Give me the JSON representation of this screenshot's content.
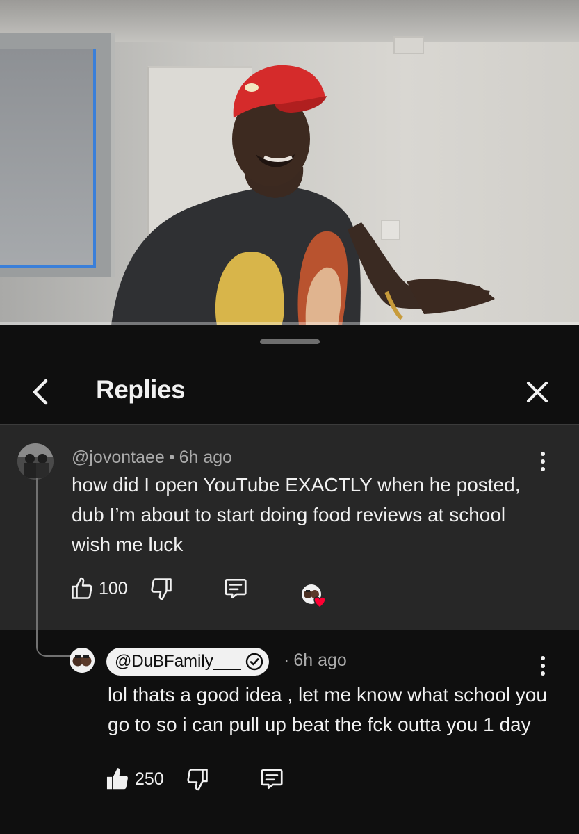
{
  "video": {
    "progress_fraction": 0.0
  },
  "header": {
    "title": "Replies",
    "back_icon": "chevron-left-icon",
    "close_icon": "close-icon"
  },
  "parent_comment": {
    "username": "@jovontaee",
    "separator": "•",
    "time": "6h ago",
    "text": "how did I open YouTube EXACTLY when he posted, dub I’m about to start doing food reviews at school wish me luck",
    "likes": "100",
    "icons": [
      "thumbs-up-icon",
      "thumbs-down-icon",
      "reply-icon",
      "creator-heart-icon",
      "more-icon"
    ]
  },
  "reply_comment": {
    "username": "@DuBFamily___",
    "verified": true,
    "separator": "·",
    "time": "6h ago",
    "text": "lol thats a good idea , let me know what school you go to so i can pull up beat the fck outta you 1 day",
    "likes": "250",
    "liked": true,
    "icons": [
      "thumbs-up-filled-icon",
      "thumbs-down-icon",
      "reply-icon",
      "verified-check-icon",
      "more-icon"
    ]
  },
  "colors": {
    "background": "#0f0f0f",
    "highlight_background": "#272727",
    "text_primary": "#f1f1f1",
    "text_secondary": "#aaaaaa",
    "heart": "#ff0033"
  }
}
